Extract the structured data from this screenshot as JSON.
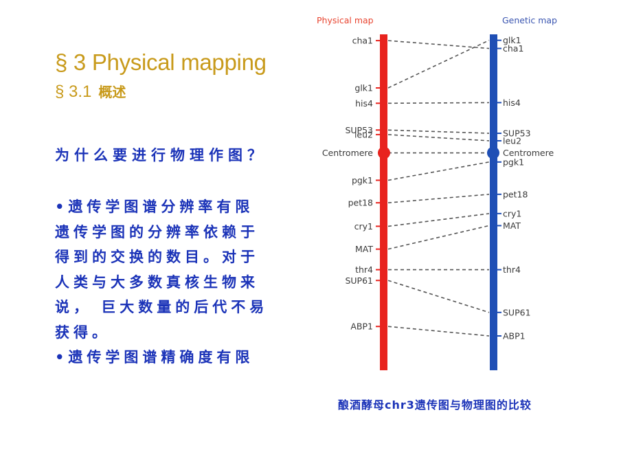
{
  "slide": {
    "title": "§ 3  Physical mapping",
    "subtitle_num": "§ 3.1",
    "subtitle_text": "概述",
    "question": "为什么要进行物理作图？",
    "body_lines": [
      "•遗传学图谱分辨率有限",
      "遗传学图的分辨率依赖于",
      "得到的交换的数目。对于",
      "人类与大多数真核生物来",
      "说， 巨大数量的后代不易",
      "获得。",
      "•遗传学图谱精确度有限"
    ],
    "caption": "酿酒酵母chr3遗传图与物理图的比较"
  },
  "diagram": {
    "physical_heading": "Physical map",
    "genetic_heading": "Genetic map",
    "colors": {
      "physical": "#e8231e",
      "genetic": "#1f4fb5",
      "connector": "#555555",
      "title": "#c89a1b",
      "text": "#1b33b8"
    },
    "loci": [
      {
        "name": "cha1",
        "physical_label": "cha1",
        "genetic_label": "cha1",
        "phys_pos": 0.015,
        "gen_pos": 0.039
      },
      {
        "name": "glk1",
        "physical_label": "glk1",
        "genetic_label": "glk1",
        "phys_pos": 0.16,
        "gen_pos": 0.014
      },
      {
        "name": "his4",
        "physical_label": "his4",
        "genetic_label": "his4",
        "phys_pos": 0.207,
        "gen_pos": 0.205
      },
      {
        "name": "SUP53",
        "physical_label": "SUP53",
        "genetic_label": "SUP53",
        "phys_pos": 0.289,
        "gen_pos": 0.299
      },
      {
        "name": "leu2",
        "physical_label": "leu2",
        "genetic_label": "leu2",
        "phys_pos": 0.303,
        "gen_pos": 0.322
      },
      {
        "name": "Centromere",
        "physical_label": "Centromere",
        "genetic_label": "Centromere",
        "phys_pos": 0.359,
        "gen_pos": 0.359,
        "centromere": true
      },
      {
        "name": "pgk1",
        "physical_label": "pgk1",
        "genetic_label": "pgk1",
        "phys_pos": 0.443,
        "gen_pos": 0.387
      },
      {
        "name": "pet18",
        "physical_label": "pet18",
        "genetic_label": "pet18",
        "phys_pos": 0.512,
        "gen_pos": 0.486
      },
      {
        "name": "cry1",
        "physical_label": "cry1",
        "genetic_label": "cry1",
        "phys_pos": 0.584,
        "gen_pos": 0.545
      },
      {
        "name": "MAT",
        "physical_label": "MAT",
        "genetic_label": "MAT",
        "phys_pos": 0.654,
        "gen_pos": 0.582
      },
      {
        "name": "thr4",
        "physical_label": "thr4",
        "genetic_label": "thr4",
        "phys_pos": 0.717,
        "gen_pos": 0.717
      },
      {
        "name": "SUP61",
        "physical_label": "SUP61",
        "genetic_label": "SUP61",
        "phys_pos": 0.75,
        "gen_pos": 0.848
      },
      {
        "name": "ABP1",
        "physical_label": "ABP1",
        "genetic_label": "ABP1",
        "phys_pos": 0.891,
        "gen_pos": 0.92
      }
    ]
  }
}
